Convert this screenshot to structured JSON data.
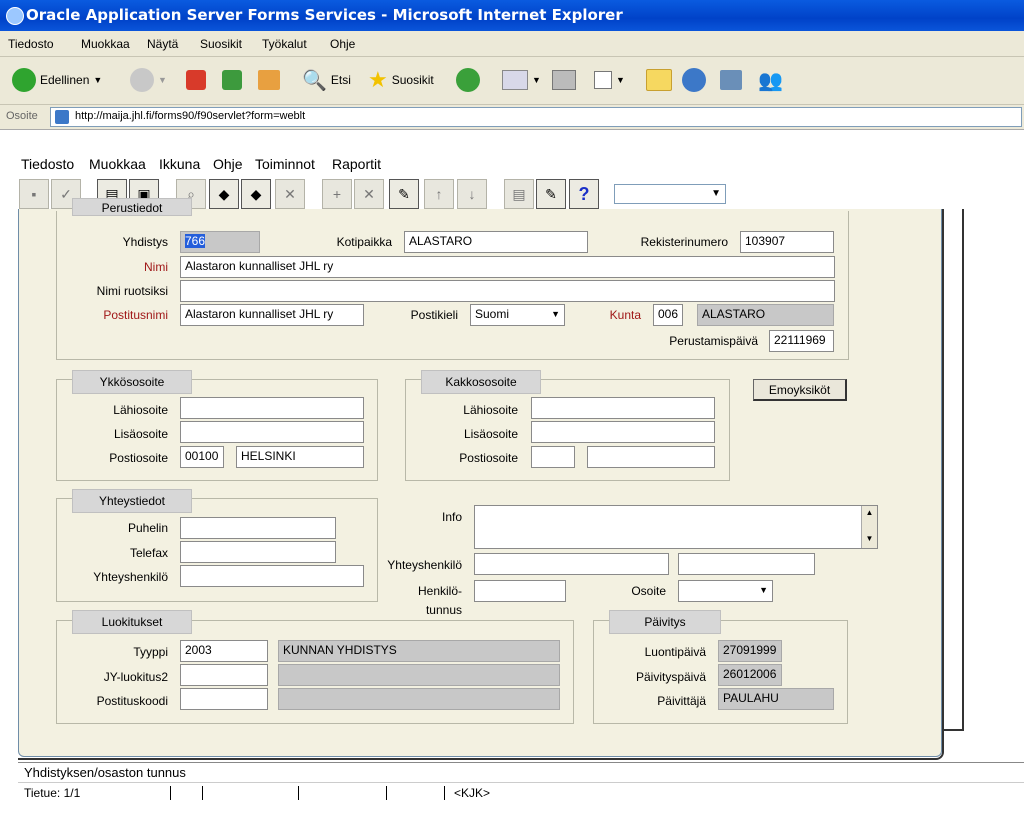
{
  "window": {
    "title": "Oracle Application Server Forms Services - Microsoft Internet Explorer"
  },
  "ie_menu": [
    "Tiedosto",
    "Muokkaa",
    "Näytä",
    "Suosikit",
    "Työkalut",
    "Ohje"
  ],
  "ie_toolbar": {
    "back": "Edellinen",
    "search": "Etsi",
    "favorites": "Suosikit"
  },
  "address": {
    "label": "Osoite",
    "url": "http://maija.jhl.fi/forms90/f90servlet?form=weblt"
  },
  "forms_menu": [
    "Tiedosto",
    "Muokkaa",
    "Ikkuna",
    "Ohje",
    "Toiminnot",
    "Raportit"
  ],
  "perustiedot": {
    "title": "Perustiedot",
    "yhdistys_label": "Yhdistys",
    "yhdistys": "766",
    "kotipaikka_label": "Kotipaikka",
    "kotipaikka": "ALASTARO",
    "rekisterinumero_label": "Rekisterinumero",
    "rekisterinumero": "103907",
    "nimi_label": "Nimi",
    "nimi": "Alastaron kunnalliset JHL ry",
    "nimi_ruotsiksi_label": "Nimi ruotsiksi",
    "nimi_ruotsiksi": "",
    "postitusnimi_label": "Postitusnimi",
    "postitusnimi": "Alastaron kunnalliset JHL ry",
    "postikieli_label": "Postikieli",
    "postikieli": "Suomi",
    "kunta_label": "Kunta",
    "kunta_code": "006",
    "kunta_name": "ALASTARO",
    "perustamispaiva_label": "Perustamispäivä",
    "perustamispaiva": "22111969"
  },
  "ykkososoite": {
    "title": "Ykkösosoite",
    "lahiosoite_label": "Lähiosoite",
    "lisaosoite_label": "Lisäosoite",
    "postiosoite_label": "Postiosoite",
    "postinumero": "00100",
    "postitoimipaikka": "HELSINKI"
  },
  "kakkososoite": {
    "title": "Kakkososoite",
    "lahiosoite_label": "Lähiosoite",
    "lisaosoite_label": "Lisäosoite",
    "postiosoite_label": "Postiosoite"
  },
  "emoyksikot_button": "Emoyksiköt",
  "yhteystiedot": {
    "title": "Yhteystiedot",
    "puhelin_label": "Puhelin",
    "telefax_label": "Telefax",
    "yhteyshenkilo_label": "Yhteyshenkilö"
  },
  "info": {
    "info_label": "Info",
    "yhteyshenkilo_label": "Yhteyshenkilö",
    "henkilotunnus_label_1": "Henkilö-",
    "henkilotunnus_label_2": "tunnus",
    "osoite_label": "Osoite"
  },
  "luokitukset": {
    "title": "Luokitukset",
    "tyyppi_label": "Tyyppi",
    "tyyppi": "2003",
    "tyyppi_desc": "KUNNAN YHDISTYS",
    "jy_label": "JY-luokitus2",
    "postituskoodi_label": "Postituskoodi"
  },
  "paivitys": {
    "title": "Päivitys",
    "luontipaiva_label": "Luontipäivä",
    "luontipaiva": "27091999",
    "paivityspaiva_label": "Päivityspäivä",
    "paivityspaiva": "26012006",
    "paivittaja_label": "Päivittäjä",
    "paivittaja": "PAULAHU"
  },
  "status": {
    "hint": "Yhdistyksen/osaston tunnus",
    "record": "Tietue: 1/1",
    "mode": "<KJK>"
  }
}
